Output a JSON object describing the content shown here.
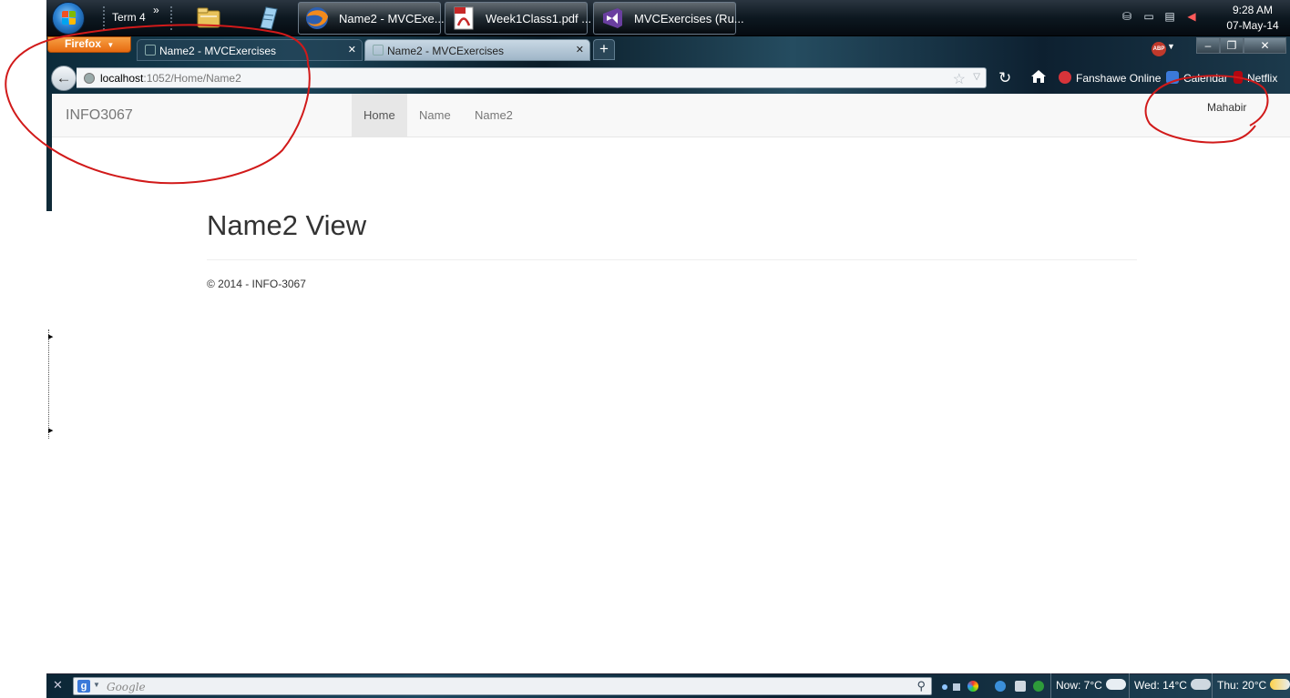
{
  "taskbar": {
    "toolbar_label": "Term 4",
    "overflow_chevron": "»",
    "pinned_icons": [
      "folder-icon",
      "notepad-icon"
    ],
    "tasks": [
      {
        "label": "Name2 - MVCExe...",
        "icon": "firefox-icon"
      },
      {
        "label": "Week1Class1.pdf ...",
        "icon": "pdf-icon"
      },
      {
        "label": "MVCExercises (Ru...",
        "icon": "visual-studio-icon"
      }
    ],
    "clock": {
      "time": "9:28 AM",
      "date": "07-May-14"
    }
  },
  "browser": {
    "menu_button": "Firefox",
    "tabs": [
      {
        "title": "Name2 - MVCExercises",
        "active": false
      },
      {
        "title": "Name2 - MVCExercises",
        "active": true
      }
    ],
    "new_tab": "+",
    "url_host": "localhost",
    "url_rest": ":1052/Home/Name2",
    "bookmarks": [
      "Fanshawe Online",
      "Calendar",
      "Netflix"
    ],
    "window_controls": {
      "minimize": "–",
      "restore": "❐",
      "close": "✕"
    }
  },
  "page": {
    "brand": "INFO3067",
    "nav": [
      {
        "label": "Home",
        "active": true
      },
      {
        "label": "Name",
        "active": false
      },
      {
        "label": "Name2",
        "active": false
      }
    ],
    "user": "Mahabir",
    "heading": "Name2 View",
    "footer": "© 2014 - INFO-3067"
  },
  "bottom_bar": {
    "close": "✕",
    "search_placeholder": "Google",
    "weather": [
      {
        "label": "Now: 7°C"
      },
      {
        "label": "Wed: 14°C"
      },
      {
        "label": "Thu: 20°C"
      }
    ]
  },
  "colors": {
    "annotation": "#d11a1a",
    "firefox_orange": "#e66a10",
    "navbar_bg": "#f8f8f8"
  }
}
